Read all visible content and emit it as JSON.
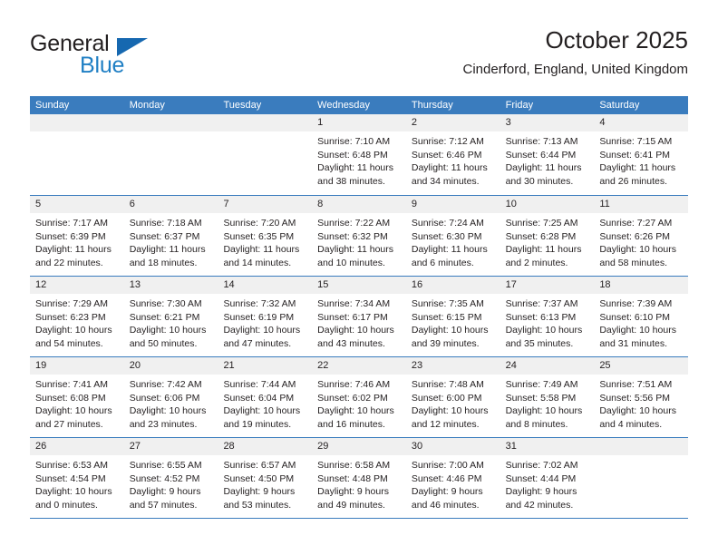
{
  "brand": {
    "word_one": "General",
    "word_two": "Blue",
    "logo_icon": "triangle-logo-icon",
    "accent_color": "#1668b0",
    "blue_text_color": "#1f7fc4"
  },
  "header": {
    "title": "October 2025",
    "subtitle": "Cinderford, England, United Kingdom"
  },
  "calendar": {
    "header_bg": "#3a7cbe",
    "header_text_color": "#ffffff",
    "daynum_band_bg": "#f0f0f0",
    "weekdays": [
      "Sunday",
      "Monday",
      "Tuesday",
      "Wednesday",
      "Thursday",
      "Friday",
      "Saturday"
    ],
    "weeks": [
      [
        {
          "day": "",
          "empty": true,
          "lines": []
        },
        {
          "day": "",
          "empty": true,
          "lines": []
        },
        {
          "day": "",
          "empty": true,
          "lines": []
        },
        {
          "day": "1",
          "lines": [
            "Sunrise: 7:10 AM",
            "Sunset: 6:48 PM",
            "Daylight: 11 hours",
            "and 38 minutes."
          ]
        },
        {
          "day": "2",
          "lines": [
            "Sunrise: 7:12 AM",
            "Sunset: 6:46 PM",
            "Daylight: 11 hours",
            "and 34 minutes."
          ]
        },
        {
          "day": "3",
          "lines": [
            "Sunrise: 7:13 AM",
            "Sunset: 6:44 PM",
            "Daylight: 11 hours",
            "and 30 minutes."
          ]
        },
        {
          "day": "4",
          "lines": [
            "Sunrise: 7:15 AM",
            "Sunset: 6:41 PM",
            "Daylight: 11 hours",
            "and 26 minutes."
          ]
        }
      ],
      [
        {
          "day": "5",
          "lines": [
            "Sunrise: 7:17 AM",
            "Sunset: 6:39 PM",
            "Daylight: 11 hours",
            "and 22 minutes."
          ]
        },
        {
          "day": "6",
          "lines": [
            "Sunrise: 7:18 AM",
            "Sunset: 6:37 PM",
            "Daylight: 11 hours",
            "and 18 minutes."
          ]
        },
        {
          "day": "7",
          "lines": [
            "Sunrise: 7:20 AM",
            "Sunset: 6:35 PM",
            "Daylight: 11 hours",
            "and 14 minutes."
          ]
        },
        {
          "day": "8",
          "lines": [
            "Sunrise: 7:22 AM",
            "Sunset: 6:32 PM",
            "Daylight: 11 hours",
            "and 10 minutes."
          ]
        },
        {
          "day": "9",
          "lines": [
            "Sunrise: 7:24 AM",
            "Sunset: 6:30 PM",
            "Daylight: 11 hours",
            "and 6 minutes."
          ]
        },
        {
          "day": "10",
          "lines": [
            "Sunrise: 7:25 AM",
            "Sunset: 6:28 PM",
            "Daylight: 11 hours",
            "and 2 minutes."
          ]
        },
        {
          "day": "11",
          "lines": [
            "Sunrise: 7:27 AM",
            "Sunset: 6:26 PM",
            "Daylight: 10 hours",
            "and 58 minutes."
          ]
        }
      ],
      [
        {
          "day": "12",
          "lines": [
            "Sunrise: 7:29 AM",
            "Sunset: 6:23 PM",
            "Daylight: 10 hours",
            "and 54 minutes."
          ]
        },
        {
          "day": "13",
          "lines": [
            "Sunrise: 7:30 AM",
            "Sunset: 6:21 PM",
            "Daylight: 10 hours",
            "and 50 minutes."
          ]
        },
        {
          "day": "14",
          "lines": [
            "Sunrise: 7:32 AM",
            "Sunset: 6:19 PM",
            "Daylight: 10 hours",
            "and 47 minutes."
          ]
        },
        {
          "day": "15",
          "lines": [
            "Sunrise: 7:34 AM",
            "Sunset: 6:17 PM",
            "Daylight: 10 hours",
            "and 43 minutes."
          ]
        },
        {
          "day": "16",
          "lines": [
            "Sunrise: 7:35 AM",
            "Sunset: 6:15 PM",
            "Daylight: 10 hours",
            "and 39 minutes."
          ]
        },
        {
          "day": "17",
          "lines": [
            "Sunrise: 7:37 AM",
            "Sunset: 6:13 PM",
            "Daylight: 10 hours",
            "and 35 minutes."
          ]
        },
        {
          "day": "18",
          "lines": [
            "Sunrise: 7:39 AM",
            "Sunset: 6:10 PM",
            "Daylight: 10 hours",
            "and 31 minutes."
          ]
        }
      ],
      [
        {
          "day": "19",
          "lines": [
            "Sunrise: 7:41 AM",
            "Sunset: 6:08 PM",
            "Daylight: 10 hours",
            "and 27 minutes."
          ]
        },
        {
          "day": "20",
          "lines": [
            "Sunrise: 7:42 AM",
            "Sunset: 6:06 PM",
            "Daylight: 10 hours",
            "and 23 minutes."
          ]
        },
        {
          "day": "21",
          "lines": [
            "Sunrise: 7:44 AM",
            "Sunset: 6:04 PM",
            "Daylight: 10 hours",
            "and 19 minutes."
          ]
        },
        {
          "day": "22",
          "lines": [
            "Sunrise: 7:46 AM",
            "Sunset: 6:02 PM",
            "Daylight: 10 hours",
            "and 16 minutes."
          ]
        },
        {
          "day": "23",
          "lines": [
            "Sunrise: 7:48 AM",
            "Sunset: 6:00 PM",
            "Daylight: 10 hours",
            "and 12 minutes."
          ]
        },
        {
          "day": "24",
          "lines": [
            "Sunrise: 7:49 AM",
            "Sunset: 5:58 PM",
            "Daylight: 10 hours",
            "and 8 minutes."
          ]
        },
        {
          "day": "25",
          "lines": [
            "Sunrise: 7:51 AM",
            "Sunset: 5:56 PM",
            "Daylight: 10 hours",
            "and 4 minutes."
          ]
        }
      ],
      [
        {
          "day": "26",
          "lines": [
            "Sunrise: 6:53 AM",
            "Sunset: 4:54 PM",
            "Daylight: 10 hours",
            "and 0 minutes."
          ]
        },
        {
          "day": "27",
          "lines": [
            "Sunrise: 6:55 AM",
            "Sunset: 4:52 PM",
            "Daylight: 9 hours",
            "and 57 minutes."
          ]
        },
        {
          "day": "28",
          "lines": [
            "Sunrise: 6:57 AM",
            "Sunset: 4:50 PM",
            "Daylight: 9 hours",
            "and 53 minutes."
          ]
        },
        {
          "day": "29",
          "lines": [
            "Sunrise: 6:58 AM",
            "Sunset: 4:48 PM",
            "Daylight: 9 hours",
            "and 49 minutes."
          ]
        },
        {
          "day": "30",
          "lines": [
            "Sunrise: 7:00 AM",
            "Sunset: 4:46 PM",
            "Daylight: 9 hours",
            "and 46 minutes."
          ]
        },
        {
          "day": "31",
          "lines": [
            "Sunrise: 7:02 AM",
            "Sunset: 4:44 PM",
            "Daylight: 9 hours",
            "and 42 minutes."
          ]
        },
        {
          "day": "",
          "empty": true,
          "lines": []
        }
      ]
    ]
  }
}
